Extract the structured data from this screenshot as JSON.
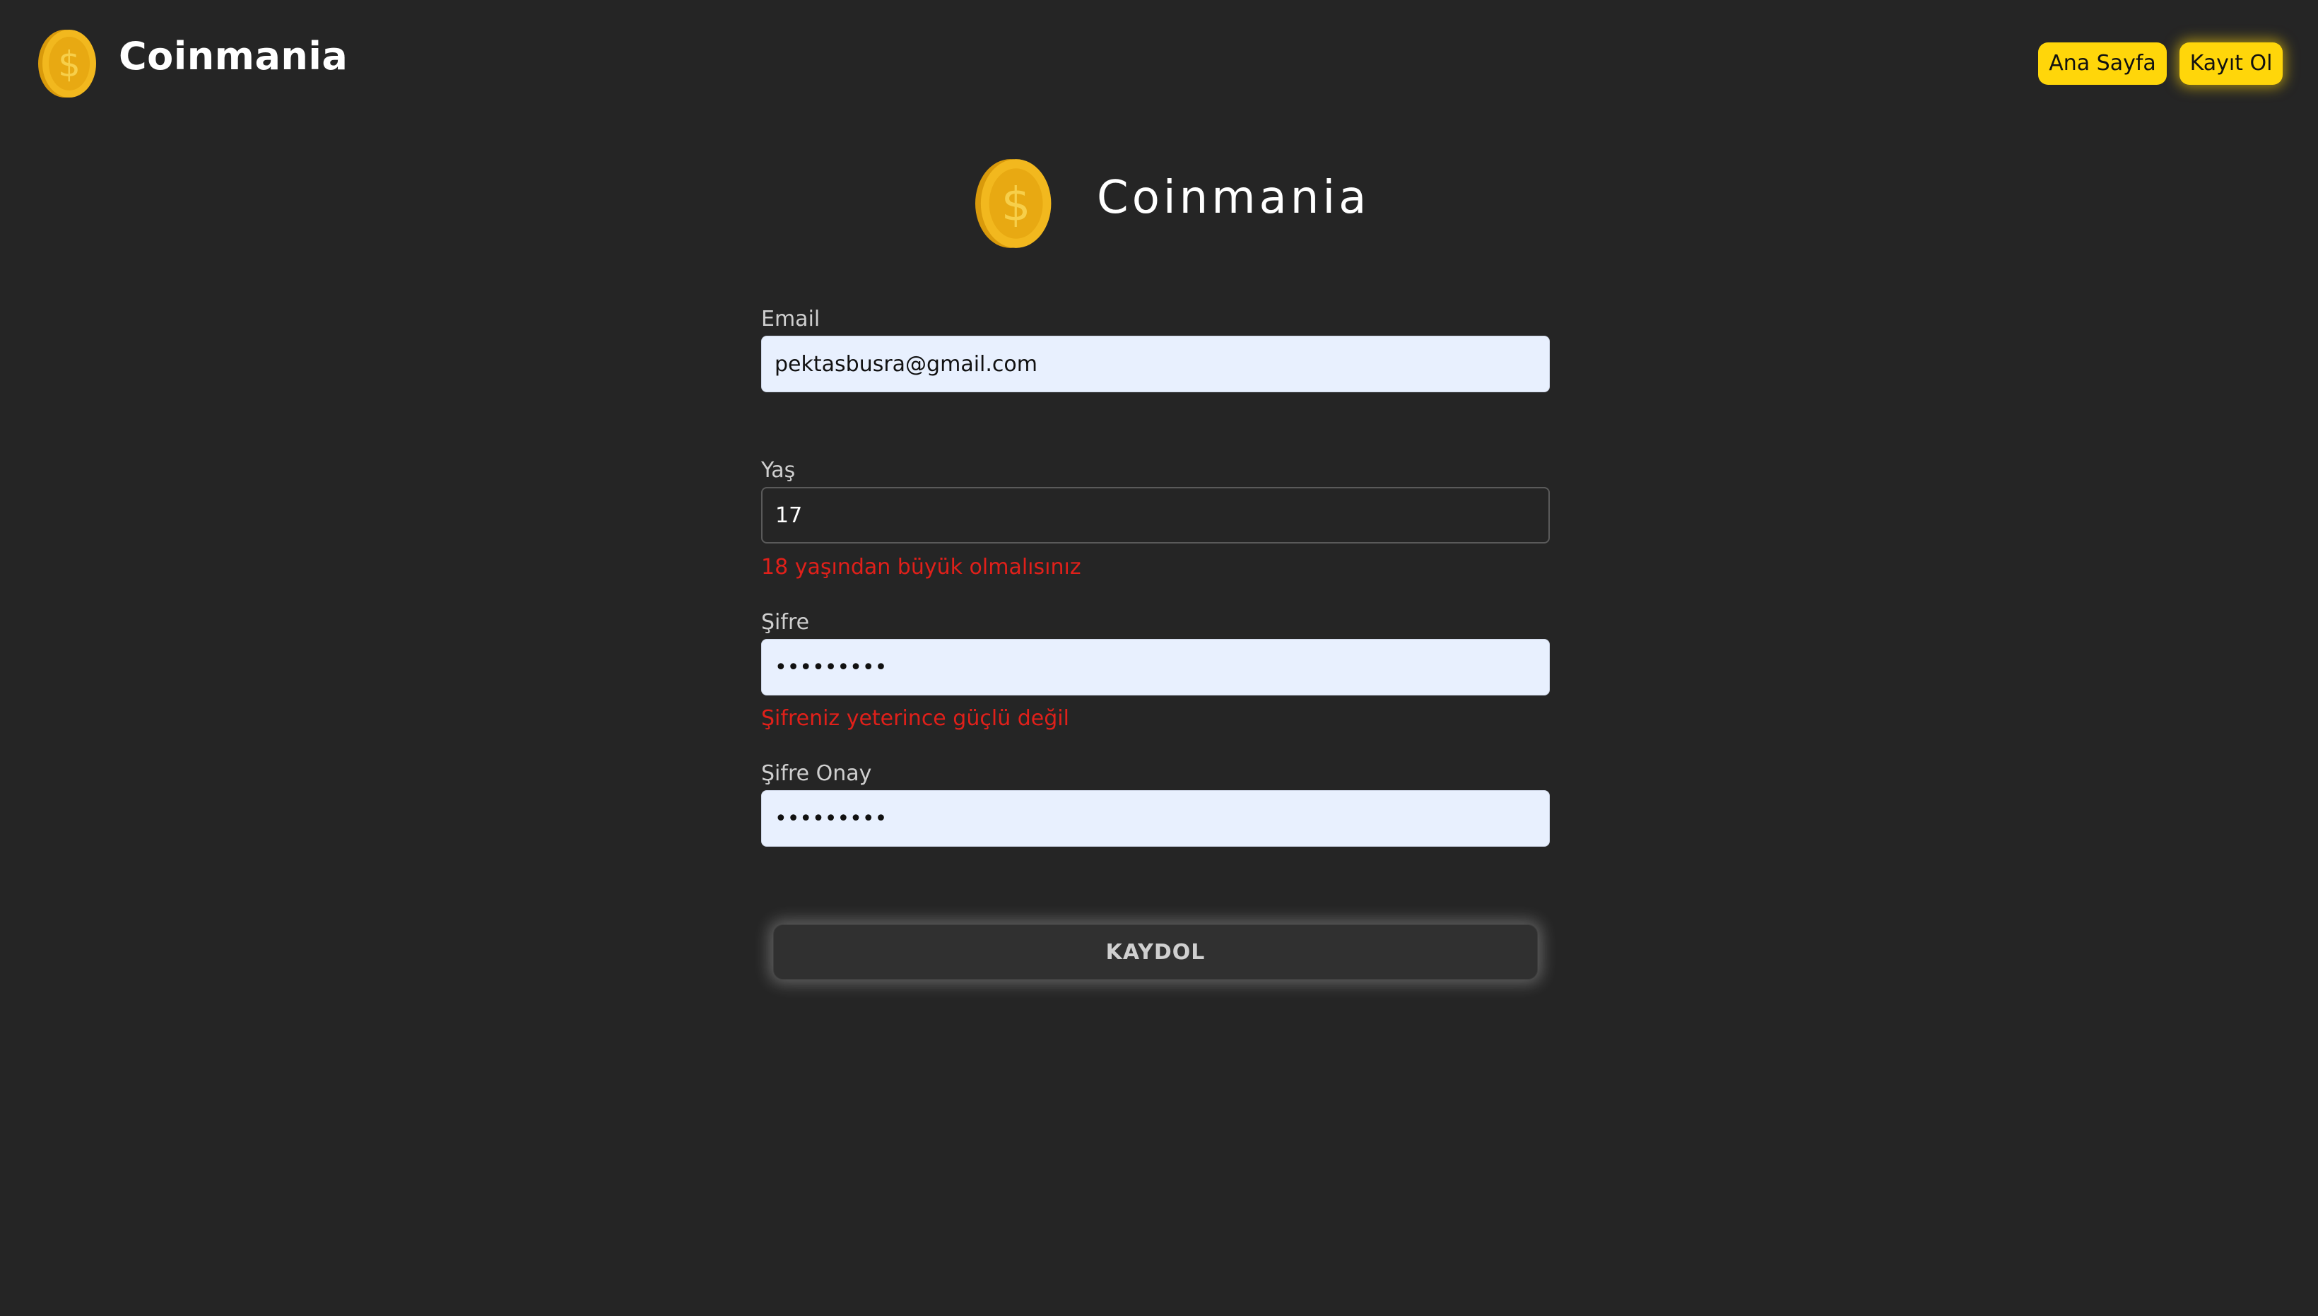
{
  "header": {
    "logo_icon": "gold-coin-dollar-icon",
    "brand": "Coinmania",
    "nav": {
      "home_label": "Ana Sayfa",
      "register_label": "Kayıt Ol"
    }
  },
  "hero": {
    "logo_icon": "gold-coin-dollar-icon",
    "title": "Coinmania"
  },
  "form": {
    "email": {
      "label": "Email",
      "value": "pektasbusra@gmail.com"
    },
    "age": {
      "label": "Yaş",
      "value": "17",
      "error": "18 yaşından büyük olmalısınız"
    },
    "password": {
      "label": "Şifre",
      "value": "password1",
      "error": "Şifreniz yeterince güçlü değil"
    },
    "password_confirm": {
      "label": "Şifre Onay",
      "value": "password1"
    },
    "submit_label": "KAYDOL"
  },
  "colors": {
    "background": "#252525",
    "accent": "#ffd60a",
    "error": "#e0201a",
    "input_fill": "#e8f0fe"
  }
}
